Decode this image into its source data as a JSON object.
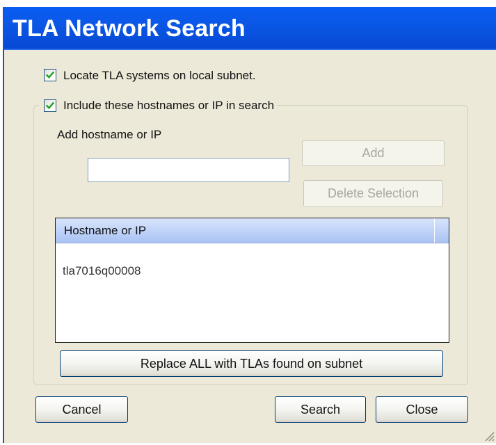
{
  "window": {
    "title": "TLA Network Search"
  },
  "options": {
    "locate_label": "Locate TLA systems on local subnet.",
    "locate_checked": true,
    "include_label": "Include these hostnames or IP in search",
    "include_checked": true
  },
  "hostname_entry": {
    "label": "Add hostname or IP",
    "value": "",
    "placeholder": ""
  },
  "buttons": {
    "add": "Add",
    "delete_selection": "Delete Selection",
    "replace_all": "Replace ALL with TLAs found on subnet",
    "cancel": "Cancel",
    "search": "Search",
    "close": "Close"
  },
  "hostname_list": {
    "columns": [
      "Hostname or IP"
    ],
    "rows": [
      "tla7016q00008"
    ]
  },
  "icons": {
    "checkbox": "checkmark-icon",
    "resize": "resize-grip-icon"
  },
  "colors": {
    "title_bar": "#0a5cf2",
    "dialog_bg": "#ece9d8",
    "list_header": "#bcd0f7",
    "checkmark": "#21a121"
  }
}
